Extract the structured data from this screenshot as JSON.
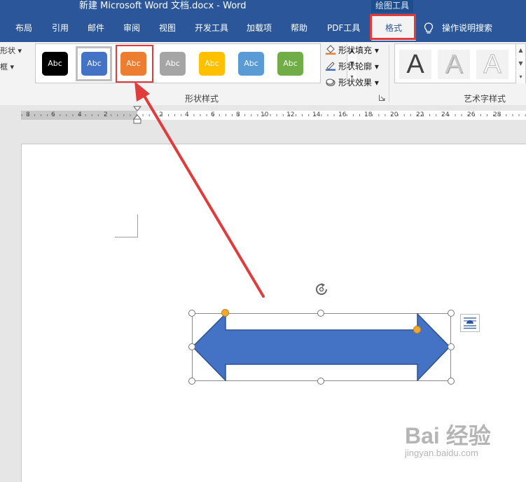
{
  "window": {
    "title": "新建 Microsoft Word 文档.docx  -  Word",
    "contextual_group": "绘图工具"
  },
  "tabs": [
    "布局",
    "引用",
    "邮件",
    "审阅",
    "视图",
    "开发工具",
    "加载项",
    "帮助",
    "PDF工具",
    "格式"
  ],
  "active_tab": "格式",
  "search_label": "操作说明搜索",
  "ribbon": {
    "left_fragments": [
      "形状",
      "框"
    ],
    "shape_styles": {
      "group_label": "形状样式",
      "swatches": [
        {
          "label": "Abc",
          "color": "#000000"
        },
        {
          "label": "Abc",
          "color": "#4472c4"
        },
        {
          "label": "Abc",
          "color": "#ed7d31"
        },
        {
          "label": "Abc",
          "color": "#a5a5a5"
        },
        {
          "label": "Abc",
          "color": "#ffc000"
        },
        {
          "label": "Abc",
          "color": "#5b9bd5"
        },
        {
          "label": "Abc",
          "color": "#70ad47"
        }
      ],
      "commands": [
        {
          "label": "形状填充",
          "icon": "paint-bucket-icon"
        },
        {
          "label": "形状轮廓",
          "icon": "pen-outline-icon"
        },
        {
          "label": "形状效果",
          "icon": "shape-effects-icon"
        }
      ]
    },
    "wordart": {
      "group_label": "艺术字样式",
      "letters": [
        "A",
        "A",
        "A"
      ]
    }
  },
  "ruler": {
    "labels": [
      "8",
      "6",
      "4",
      "2",
      "2",
      "4",
      "6",
      "8",
      "10",
      "12",
      "14",
      "16",
      "18",
      "20",
      "22",
      "24",
      "26",
      "28"
    ]
  },
  "watermark": {
    "logo": "Bai 经验",
    "url": "jingyan.baidu.com"
  },
  "colors": {
    "ribbon_blue": "#2b579a",
    "annotation_red": "#e03c3c",
    "arrow_fill": "#4472c4",
    "arrow_stroke": "#2f528f",
    "adjust_handle": "#f0a830"
  }
}
